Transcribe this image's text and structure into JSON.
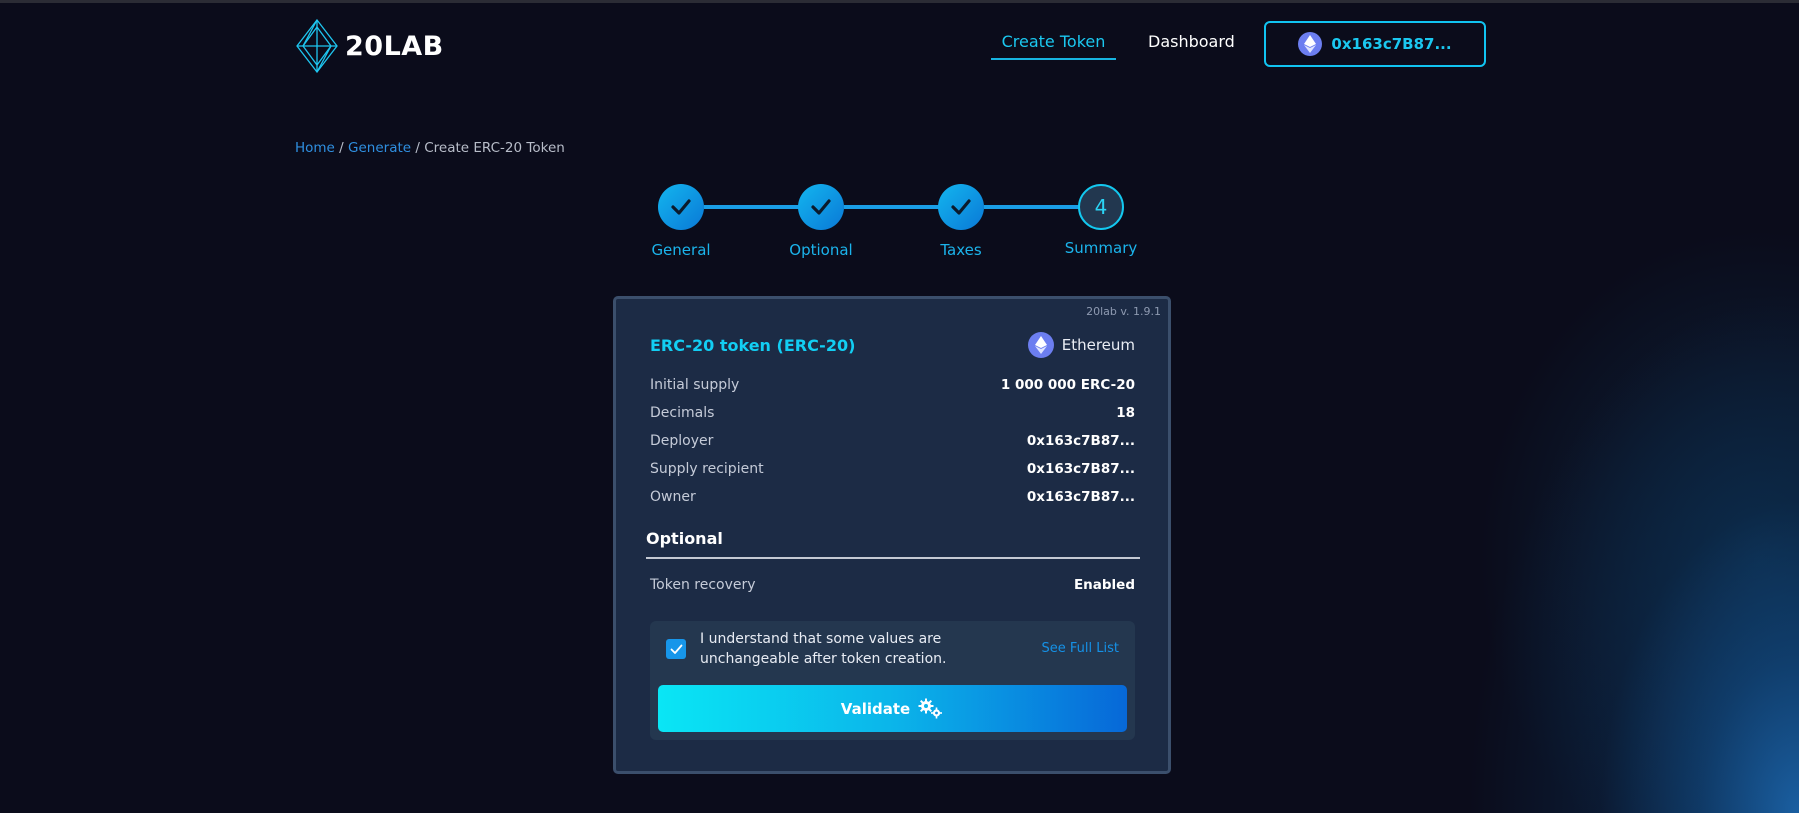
{
  "app": {
    "name": "20LAB"
  },
  "nav": {
    "create_token": "Create Token",
    "dashboard": "Dashboard",
    "wallet_address": "0x163c7B87..."
  },
  "breadcrumb": {
    "home": "Home",
    "generate": "Generate",
    "current": "Create ERC-20 Token",
    "separator": "/"
  },
  "stepper": {
    "steps": [
      {
        "label": "General",
        "state": "done"
      },
      {
        "label": "Optional",
        "state": "done"
      },
      {
        "label": "Taxes",
        "state": "done"
      },
      {
        "label": "Summary",
        "state": "active",
        "number": "4"
      }
    ]
  },
  "card": {
    "version": "20lab v. 1.9.1",
    "title": "ERC-20 token (ERC-20)",
    "network": "Ethereum",
    "rows": [
      {
        "label": "Initial supply",
        "value": "1 000 000 ERC-20"
      },
      {
        "label": "Decimals",
        "value": "18"
      },
      {
        "label": "Deployer",
        "value": "0x163c7B87..."
      },
      {
        "label": "Supply recipient",
        "value": "0x163c7B87..."
      },
      {
        "label": "Owner",
        "value": "0x163c7B87..."
      }
    ],
    "optional_title": "Optional",
    "optional_rows": [
      {
        "label": "Token recovery",
        "value": "Enabled"
      }
    ],
    "confirm_text": "I understand that some values are unchangeable after token creation.",
    "confirm_checked": true,
    "see_full_list": "See Full List",
    "validate_label": "Validate"
  },
  "colors": {
    "accent": "#12cef3",
    "link": "#1591e6",
    "background": "#0b0c1b",
    "card": "#1c2b45"
  },
  "icons": {
    "logo": "diamond-logo-icon",
    "network": "ethereum-icon",
    "check": "check-icon",
    "validate": "gears-icon"
  }
}
